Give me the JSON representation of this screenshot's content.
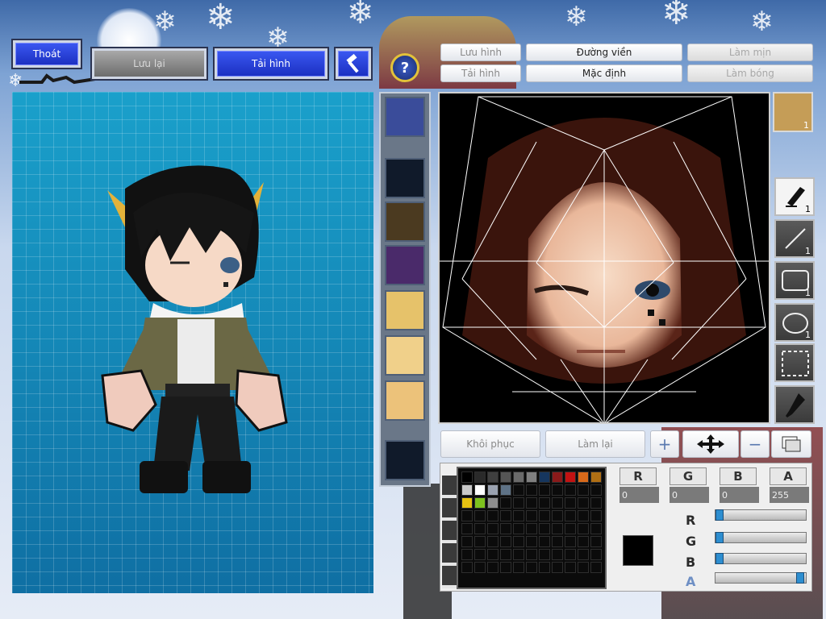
{
  "toolbar": {
    "exit_label": "Thoát",
    "save_label": "Lưu lại",
    "load_label": "Tải hình",
    "help_glyph": "?"
  },
  "face_tabs": {
    "save_image": "Lưu hình",
    "load_image": "Tải hình",
    "outline": "Đường viền",
    "default": "Mặc định",
    "smooth": "Làm mịn",
    "shadow": "Làm bóng"
  },
  "bottom_buttons": {
    "restore": "Khôi phục",
    "redo": "Làm lại"
  },
  "tools": [
    {
      "name": "pen-icon",
      "count": "1"
    },
    {
      "name": "line-icon",
      "count": "1"
    },
    {
      "name": "rectangle-icon",
      "count": "1"
    },
    {
      "name": "ellipse-icon",
      "count": "1"
    },
    {
      "name": "select-icon",
      "count": ""
    },
    {
      "name": "eyedropper-icon",
      "count": ""
    }
  ],
  "face_preset_count": "1",
  "color": {
    "headers": [
      "R",
      "G",
      "B",
      "A"
    ],
    "values": [
      "0",
      "0",
      "0",
      "255"
    ],
    "slider_labels": [
      "R",
      "G",
      "B",
      "A"
    ],
    "current": "#000000"
  },
  "palette": [
    "#000000",
    "#2a2a2a",
    "#3f3f3f",
    "#555555",
    "#6a6a6a",
    "#808080",
    "#16365e",
    "#8a1a1a",
    "#c21212",
    "#d8691a",
    "#b06f14",
    "#c9c9c9",
    "#ffffff",
    "#9aa2b0",
    "#5e7286",
    "#0b0b0b",
    "#0b0b0b",
    "#0b0b0b",
    "#0b0b0b",
    "#0b0b0b",
    "#0b0b0b",
    "#0b0b0b",
    "#e6c212",
    "#7ec21e",
    "#8e8e8e"
  ],
  "colors": {
    "accent_blue": "#1b2fc0",
    "canvas_blue": "#1591bd"
  }
}
